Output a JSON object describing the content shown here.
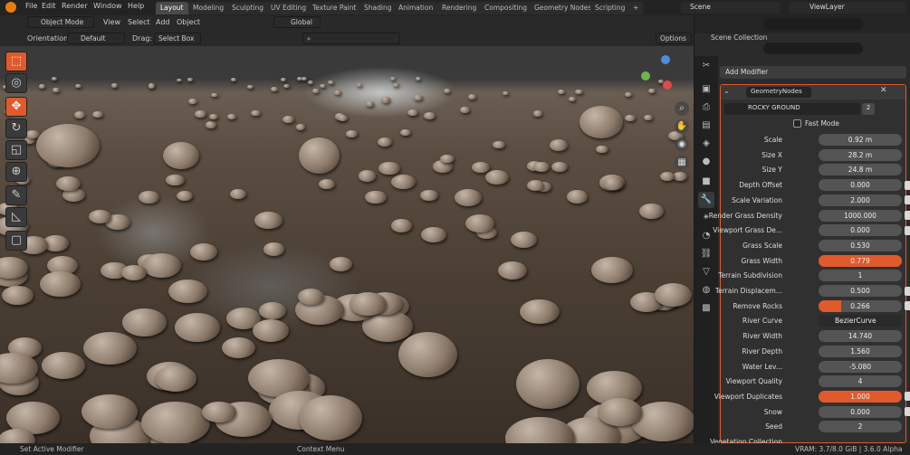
{
  "menu": {
    "file": "File",
    "edit": "Edit",
    "render": "Render",
    "window": "Window",
    "help": "Help"
  },
  "workspaces": [
    "Layout",
    "Modeling",
    "Sculpting",
    "UV Editing",
    "Texture Paint",
    "Shading",
    "Animation",
    "Rendering",
    "Compositing",
    "Geometry Nodes",
    "Scripting"
  ],
  "add_workspace": "+",
  "scene": {
    "label": "Scene",
    "view_layer": "ViewLayer"
  },
  "viewport_header": {
    "mode": "Object Mode",
    "view": "View",
    "select": "Select",
    "add": "Add",
    "object": "Object",
    "transform": "Global",
    "orientation_label": "Orientation:",
    "orientation": "Default",
    "drag_label": "Drag:",
    "drag": "Select Box",
    "options": "Options"
  },
  "outliner": {
    "collection": "Scene Collection"
  },
  "properties": {
    "add_modifier": "Add Modifier",
    "modifier_name": "GeometryNodes",
    "node_group": "ROCKY GROUND",
    "users": "2",
    "fast_mode": "Fast Mode",
    "rows": [
      {
        "label": "Scale",
        "value": "0.92 m",
        "fill": 0,
        "socket": false
      },
      {
        "label": "Size X",
        "value": "28.2 m",
        "fill": 0,
        "socket": false
      },
      {
        "label": "Size Y",
        "value": "24.8 m",
        "fill": 0,
        "socket": false
      },
      {
        "label": "Depth Offset",
        "value": "0.000",
        "fill": 0,
        "socket": true
      },
      {
        "label": "Scale Variation",
        "value": "2.000",
        "fill": 0,
        "socket": true
      },
      {
        "label": "Render Grass Density",
        "value": "1000.000",
        "fill": 0,
        "socket": true
      },
      {
        "label": "Viewport Grass De...",
        "value": "0.000",
        "fill": 0,
        "socket": true
      },
      {
        "label": "Grass Scale",
        "value": "0.530",
        "fill": 0,
        "socket": false
      },
      {
        "label": "Grass Width",
        "value": "0.779",
        "fill": 1,
        "socket": false
      },
      {
        "label": "Terrain Subdivision",
        "value": "1",
        "fill": 0,
        "socket": false
      },
      {
        "label": "Terrain Displacem...",
        "value": "0.500",
        "fill": 0,
        "socket": true
      },
      {
        "label": "Remove Rocks",
        "value": "0.266",
        "fill": 0.27,
        "socket": true
      },
      {
        "label": "River Curve",
        "value": "BezierCurve",
        "fill": 0,
        "socket": false
      },
      {
        "label": "River Width",
        "value": "14.740",
        "fill": 0,
        "socket": false
      },
      {
        "label": "River Depth",
        "value": "1.560",
        "fill": 0,
        "socket": false
      },
      {
        "label": "Water Lev...",
        "value": "-5.080",
        "fill": 0,
        "socket": false
      },
      {
        "label": "Viewport Quality",
        "value": "4",
        "fill": 0,
        "socket": false
      },
      {
        "label": "Viewport Duplicates",
        "value": "1.000",
        "fill": 1,
        "socket": true
      },
      {
        "label": "Snow",
        "value": "0.000",
        "fill": 0,
        "socket": true
      },
      {
        "label": "Seed",
        "value": "2",
        "fill": 0,
        "socket": false
      },
      {
        "label": "Vegetation Collection",
        "value": "",
        "fill": 0,
        "socket": false
      }
    ]
  },
  "status": {
    "left": "Set Active Modifier",
    "middle": "Context Menu",
    "right": "VRAM: 3.7/8.0 GiB | 3.6.0 Alpha"
  },
  "colors": {
    "accent": "#e05a2b",
    "panel": "#2b2b2b",
    "field": "#545454"
  }
}
